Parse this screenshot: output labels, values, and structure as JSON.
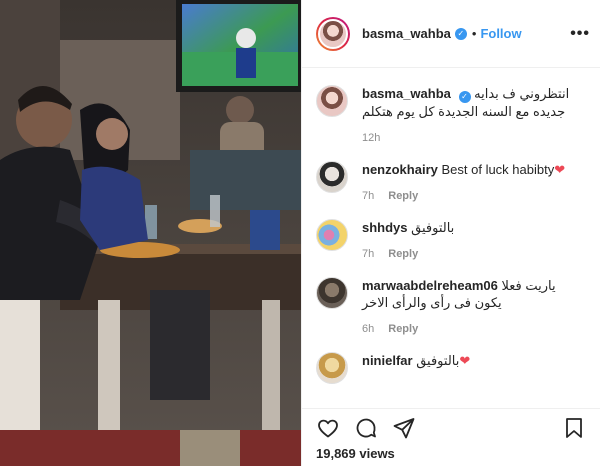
{
  "post": {
    "username": "basma_wahba",
    "follow_label": "Follow",
    "more_label": "•••",
    "separator": "•"
  },
  "caption": {
    "username": "basma_wahba",
    "text_line1": "انتظروني ف بدايه",
    "text_line2": "جديده مع السنه الجديدة كل يوم هتكلم",
    "time": "12h"
  },
  "comments": [
    {
      "username": "nenzokhairy",
      "text": "Best of luck habibty",
      "time": "7h",
      "reply": "Reply",
      "heart": "❤"
    },
    {
      "username": "shhdys",
      "text": "بالتوفيق",
      "time": "7h",
      "reply": "Reply"
    },
    {
      "username": "marwaabdelreheam06",
      "text": "ياريت فعلا",
      "text2": "يكون فى رأى والرأى الاخر",
      "time": "6h",
      "reply": "Reply"
    },
    {
      "username": "ninielfar",
      "text": "بالتوفيق",
      "heart": "❤"
    }
  ],
  "actions": {
    "icons": [
      "heart-icon",
      "comment-icon",
      "share-icon",
      "bookmark-icon"
    ]
  },
  "stats": {
    "views": "19,869 views"
  },
  "colors": {
    "accent": "#3897f0",
    "text": "#262626",
    "muted": "#8e8e8e",
    "heart": "#ed4956"
  }
}
